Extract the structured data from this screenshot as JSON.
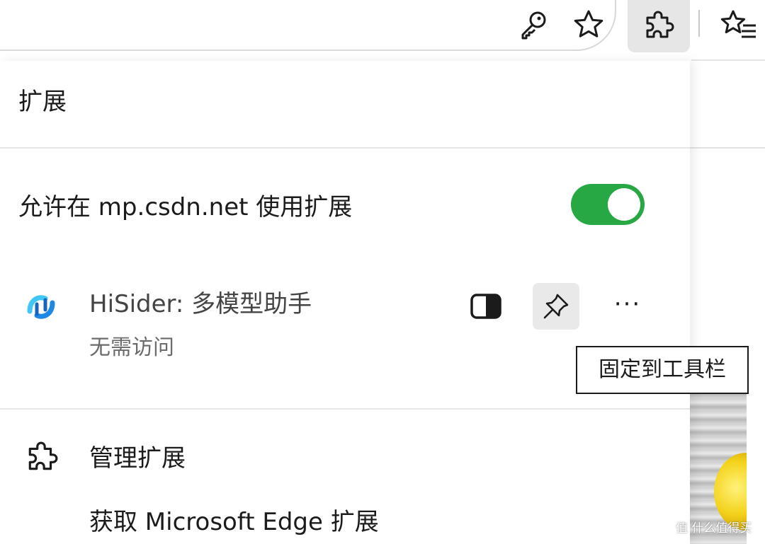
{
  "toolbar": {
    "icons": {
      "password": "key-icon",
      "favorite": "star-icon",
      "extensions": "puzzle-icon",
      "favorites_list": "star-list-icon"
    }
  },
  "panel": {
    "title": "扩展",
    "site_access": {
      "label": "允许在 mp.csdn.net 使用扩展",
      "enabled": true,
      "toggle_color": "#28a745"
    },
    "extensions": [
      {
        "name": "HiSider: 多模型助手",
        "access": "无需访问",
        "logo_colors": [
          "#1e88e5",
          "#42c6f5"
        ],
        "pinned": false
      }
    ],
    "pin_tooltip": "固定到工具栏",
    "more_label": "···",
    "footer": {
      "manage": "管理扩展",
      "get": "获取 Microsoft Edge 扩展"
    }
  },
  "watermark": "值 什么值得买"
}
